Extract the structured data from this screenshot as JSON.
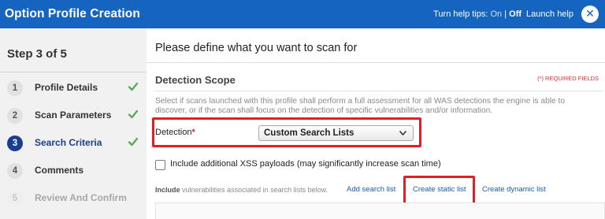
{
  "header": {
    "title": "Option Profile Creation",
    "help_tips_label": "Turn help tips:",
    "help_on": "On",
    "help_separator": "|",
    "help_off": "Off",
    "launch_help": "Launch help",
    "close_glyph": "✕"
  },
  "sidebar": {
    "step_count": "Step 3 of 5",
    "steps": [
      {
        "num": "1",
        "label": "Profile Details",
        "status": "complete"
      },
      {
        "num": "2",
        "label": "Scan Parameters",
        "status": "complete"
      },
      {
        "num": "3",
        "label": "Search Criteria",
        "status": "active"
      },
      {
        "num": "4",
        "label": "Comments",
        "status": "upcoming"
      },
      {
        "num": "5",
        "label": "Review And Confirm",
        "status": "disabled"
      }
    ]
  },
  "main": {
    "title": "Please define what you want to scan for",
    "section_title": "Detection Scope",
    "required_note": "(*) REQUIRED FIELDS",
    "description": "Select if scans launched with this profile shall perform a full assessment for all WAS detections the engine is able to discover, or if the scan shall focus on the detection of specific vulnerabilities and/or information.",
    "detection": {
      "label": "Detection",
      "required_marker": "*",
      "selected": "Custom Search Lists"
    },
    "xss_checkbox": {
      "checked": false,
      "label": "Include additional XSS payloads (may significantly increase scan time)"
    },
    "include": {
      "bold": "Include",
      "text": "vulnerabilities associated in search lists below.",
      "add_search_list": "Add search list",
      "create_static_list": "Create static list",
      "create_dynamic_list": "Create dynamic list"
    }
  },
  "colors": {
    "header_bg": "#1565c0",
    "active_step": "#1a3d8f",
    "check_green": "#5ca85c",
    "highlight_red": "#e31e24",
    "link_blue": "#1a5bb5",
    "required_red": "#d32f2f"
  },
  "icons": {
    "close": "close-icon",
    "check": "check-icon",
    "dropdown": "chevron-down-icon"
  }
}
